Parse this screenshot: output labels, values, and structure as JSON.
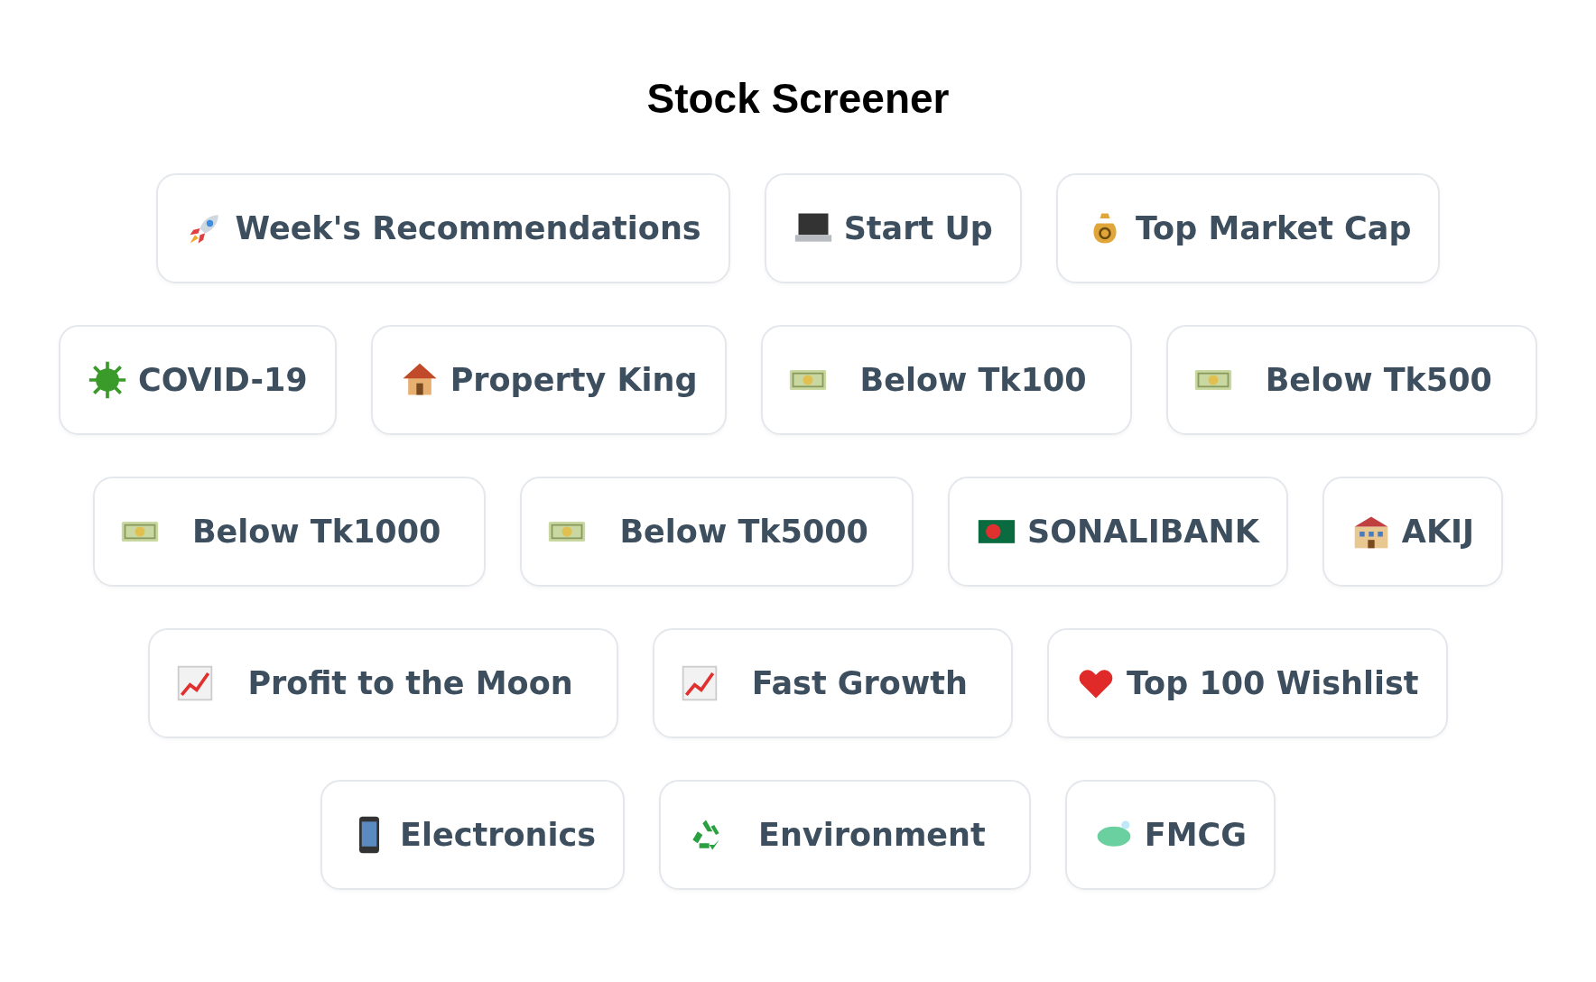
{
  "title": "Stock Screener",
  "rows": [
    {
      "chips": [
        {
          "label": "Week's Recommendations"
        },
        {
          "label": "Start Up"
        },
        {
          "label": "Top Market Cap"
        }
      ]
    },
    {
      "chips": [
        {
          "label": "COVID-19"
        },
        {
          "label": "Property King"
        },
        {
          "label": "Below Tk100"
        },
        {
          "label": "Below Tk500"
        }
      ]
    },
    {
      "chips": [
        {
          "label": "Below Tk1000"
        },
        {
          "label": "Below Tk5000"
        },
        {
          "label": "SONALIBANK"
        },
        {
          "label": "AKIJ"
        }
      ]
    },
    {
      "chips": [
        {
          "label": "Profit to the Moon"
        },
        {
          "label": "Fast Growth"
        },
        {
          "label": "Top 100 Wishlist"
        }
      ]
    },
    {
      "chips": [
        {
          "label": "Electronics"
        },
        {
          "label": "Environment"
        },
        {
          "label": "FMCG"
        }
      ]
    }
  ]
}
